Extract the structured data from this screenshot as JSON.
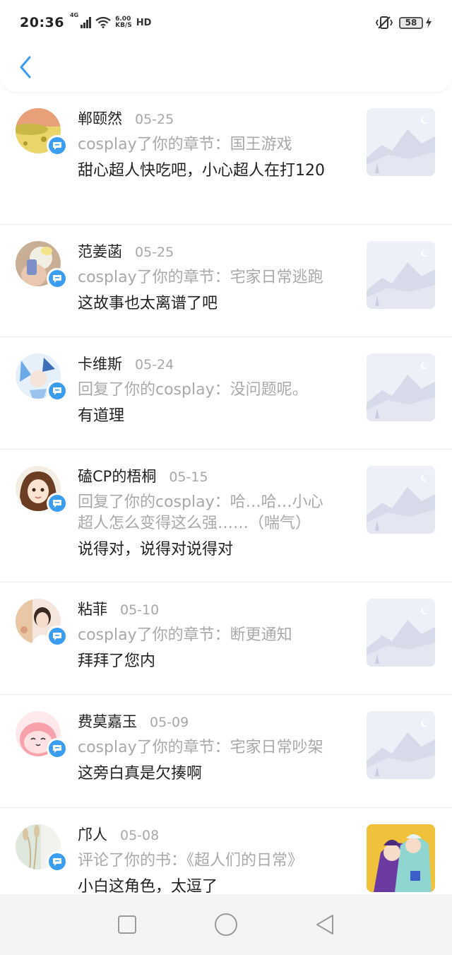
{
  "status_bar": {
    "time": "20:36",
    "network": "4G",
    "speed_value": "6.00",
    "speed_unit": "KB/S",
    "hd": "HD",
    "battery": "58"
  },
  "colors": {
    "accent": "#3a9df0",
    "date": "#a8a8a8",
    "action": "#a9a9a9"
  },
  "items": [
    {
      "name": "郸颐然",
      "date": "05-25",
      "action": "cosplay了你的章节：国王游戏",
      "comment": "甜心超人快吃吧，小心超人在打120",
      "avatar_icon": "yellow-field-avatar",
      "thumb": "placeholder-mountain"
    },
    {
      "name": "范姜菡",
      "date": "05-25",
      "action": "cosplay了你的章节：宅家日常逃跑",
      "comment": "这故事也太离谱了吧",
      "avatar_icon": "girl-phone-avatar",
      "thumb": "placeholder-mountain"
    },
    {
      "name": "卡维斯",
      "date": "05-24",
      "action": "回复了你的cosplay：没问题呢。",
      "comment": "有道理",
      "avatar_icon": "anime-blue-avatar",
      "thumb": "placeholder-mountain"
    },
    {
      "name": "磕CP的梧桐",
      "date": "05-15",
      "action": "回复了你的cosplay：哈…哈…小心超人怎么变得这么强……（喘气）",
      "comment": "说得对，说得对说得对",
      "avatar_icon": "anime-girl-avatar",
      "thumb": "placeholder-mountain"
    },
    {
      "name": "粘菲",
      "date": "05-10",
      "action": "cosplay了你的章节：断更通知",
      "comment": "拜拜了您内",
      "avatar_icon": "girl-photo-avatar",
      "thumb": "placeholder-mountain"
    },
    {
      "name": "费莫嘉玉",
      "date": "05-09",
      "action": "cosplay了你的章节：宅家日常吵架",
      "comment": "这旁白真是欠揍啊",
      "avatar_icon": "pink-cartoon-avatar",
      "thumb": "placeholder-mountain"
    },
    {
      "name": "邝人",
      "date": "05-08",
      "action": "评论了你的书：《超人们的日常》",
      "comment": "小白这角色，太逗了",
      "avatar_icon": "reed-photo-avatar",
      "thumb": "book-cover"
    }
  ],
  "nav": {
    "recent": "square-icon",
    "home": "circle-icon",
    "back": "triangle-icon"
  }
}
